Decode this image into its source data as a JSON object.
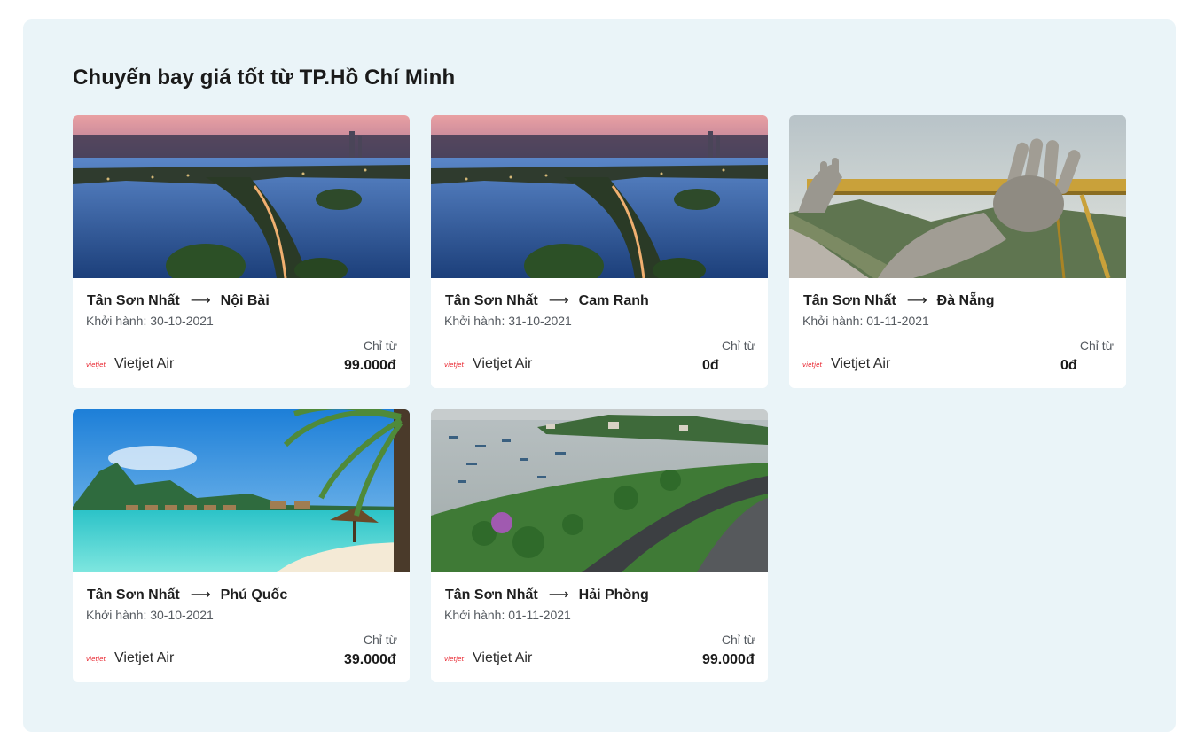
{
  "section": {
    "title": "Chuyến bay giá tốt từ TP.Hồ Chí Minh"
  },
  "cards": [
    {
      "origin": "Tân Sơn Nhất",
      "arrow": "⟶",
      "destination": "Nội Bài",
      "departure": "Khởi hành: 30-10-2021",
      "airline": "Vietjet Air",
      "from_label": "Chỉ từ",
      "price": "99.000đ",
      "image": "hanoi-west-lake-sunset"
    },
    {
      "origin": "Tân Sơn Nhất",
      "arrow": "⟶",
      "destination": "Cam Ranh",
      "departure": "Khởi hành: 31-10-2021",
      "airline": "Vietjet Air",
      "from_label": "Chỉ từ",
      "price": "0đ",
      "image": "hanoi-west-lake-sunset"
    },
    {
      "origin": "Tân Sơn Nhất",
      "arrow": "⟶",
      "destination": "Đà Nẵng",
      "departure": "Khởi hành: 01-11-2021",
      "airline": "Vietjet Air",
      "from_label": "Chỉ từ",
      "price": "0đ",
      "image": "golden-bridge-hands"
    },
    {
      "origin": "Tân Sơn Nhất",
      "arrow": "⟶",
      "destination": "Phú Quốc",
      "departure": "Khởi hành: 30-10-2021",
      "airline": "Vietjet Air",
      "from_label": "Chỉ từ",
      "price": "39.000đ",
      "image": "tropical-beach-palms"
    },
    {
      "origin": "Tân Sơn Nhất",
      "arrow": "⟶",
      "destination": "Hải Phòng",
      "departure": "Khởi hành: 01-11-2021",
      "airline": "Vietjet Air",
      "from_label": "Chỉ từ",
      "price": "99.000đ",
      "image": "coastal-bay-road"
    }
  ],
  "colors": {
    "panel_bg": "#eaf4f8",
    "card_bg": "#ffffff",
    "airline_logo": "#e8202a"
  }
}
